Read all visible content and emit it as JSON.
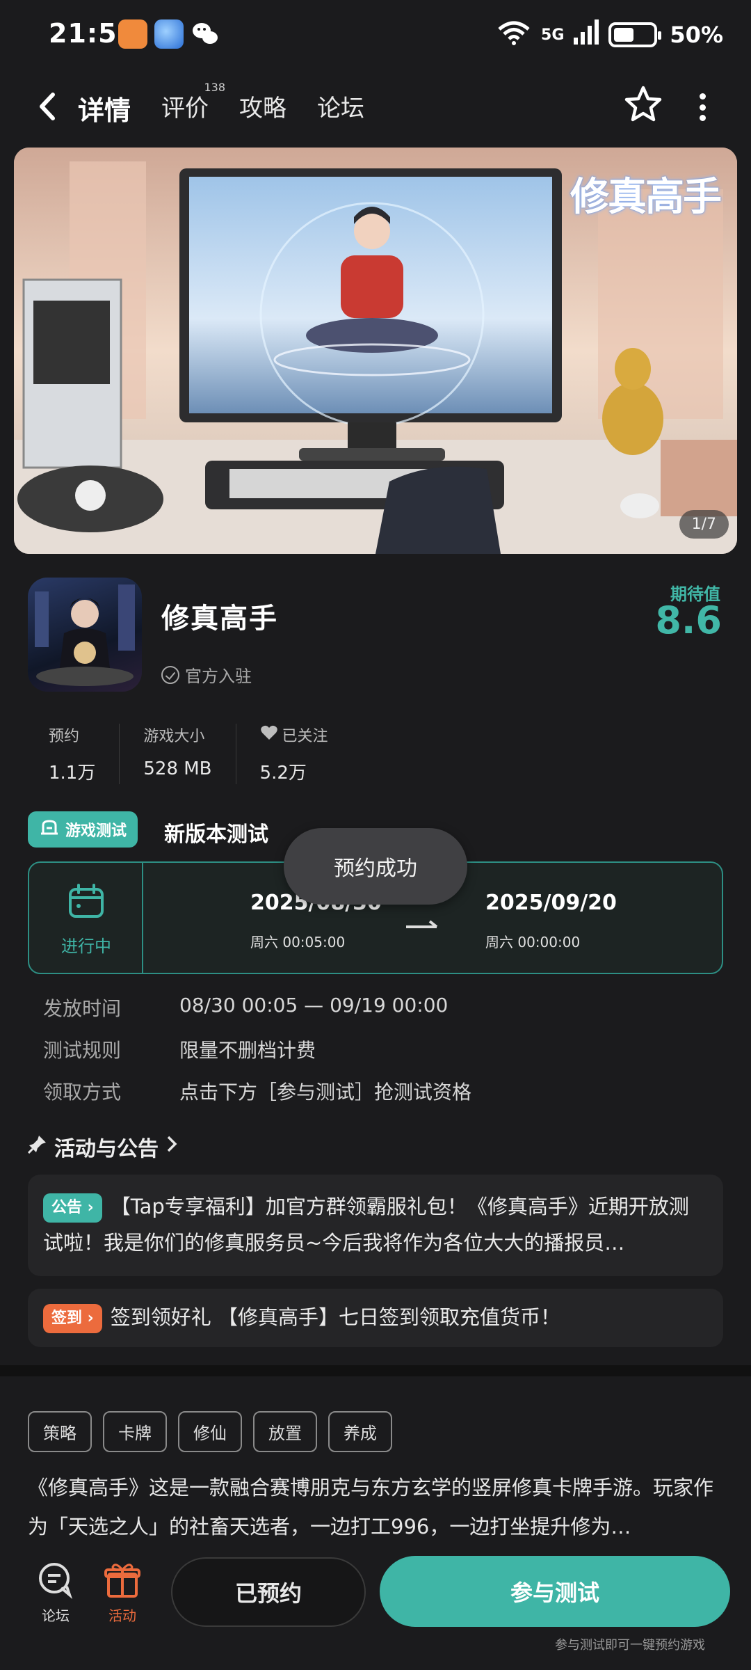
{
  "status_bar": {
    "time": "21:57",
    "wifi_label": "6",
    "network": "5G",
    "battery": "50%",
    "battery_level": 0.5
  },
  "nav": {
    "tabs": [
      {
        "label": "详情",
        "active": true
      },
      {
        "label": "评价",
        "badge": "138"
      },
      {
        "label": "攻略"
      },
      {
        "label": "论坛"
      }
    ]
  },
  "banner": {
    "logo_text": "修真高手",
    "page_indicator": "1/7"
  },
  "game": {
    "title": "修真高手",
    "official": "官方入驻",
    "expect_label": "期待值",
    "expect_value": "8.6",
    "stats": [
      {
        "label": "预约",
        "value": "1.1万"
      },
      {
        "label": "游戏大小",
        "value": "528 MB"
      },
      {
        "label": "已关注",
        "value": "5.2万",
        "icon": "heart-icon"
      }
    ]
  },
  "test": {
    "tag": "游戏测试",
    "title": "新版本测试",
    "status": "进行中",
    "start_date": "2025/08/30",
    "start_sub": "周六 00:05:00",
    "end_date": "2025/09/20",
    "end_sub": "周六 00:00:00",
    "rules": [
      {
        "key": "发放时间",
        "value": "08/30 00:05 — 09/19 00:00"
      },
      {
        "key": "测试规则",
        "value": "限量不删档计费"
      },
      {
        "key": "领取方式",
        "value": "点击下方［参与测试］抢测试资格"
      }
    ]
  },
  "toast": "预约成功",
  "notices": {
    "heading": "活动与公告",
    "items": [
      {
        "pill": "公告",
        "text": "【Tap专享福利】加官方群领霸服礼包！《修真高手》近期开放测试啦！我是你们的修真服务员~今后我将作为各位大大的播报员…"
      },
      {
        "pill": "签到",
        "text": "签到领好礼 【修真高手】七日签到领取充值货币！"
      }
    ]
  },
  "tags": [
    "策略",
    "卡牌",
    "修仙",
    "放置",
    "养成"
  ],
  "description": "《修真高手》这是一款融合赛博朋克与东方玄学的竖屏修真卡牌手游。玩家作为「天选之人」的社畜天选者，一边打工996，一边打坐提升修为…",
  "bottom_bar": {
    "forum": "论坛",
    "activity": "活动",
    "reserved": "已预约",
    "join": "参与测试",
    "hint": "参与测试即可一键预约游戏"
  },
  "colors": {
    "accent": "#3fb5a6",
    "orange": "#ec6b3d",
    "background": "#1b1b1d"
  }
}
